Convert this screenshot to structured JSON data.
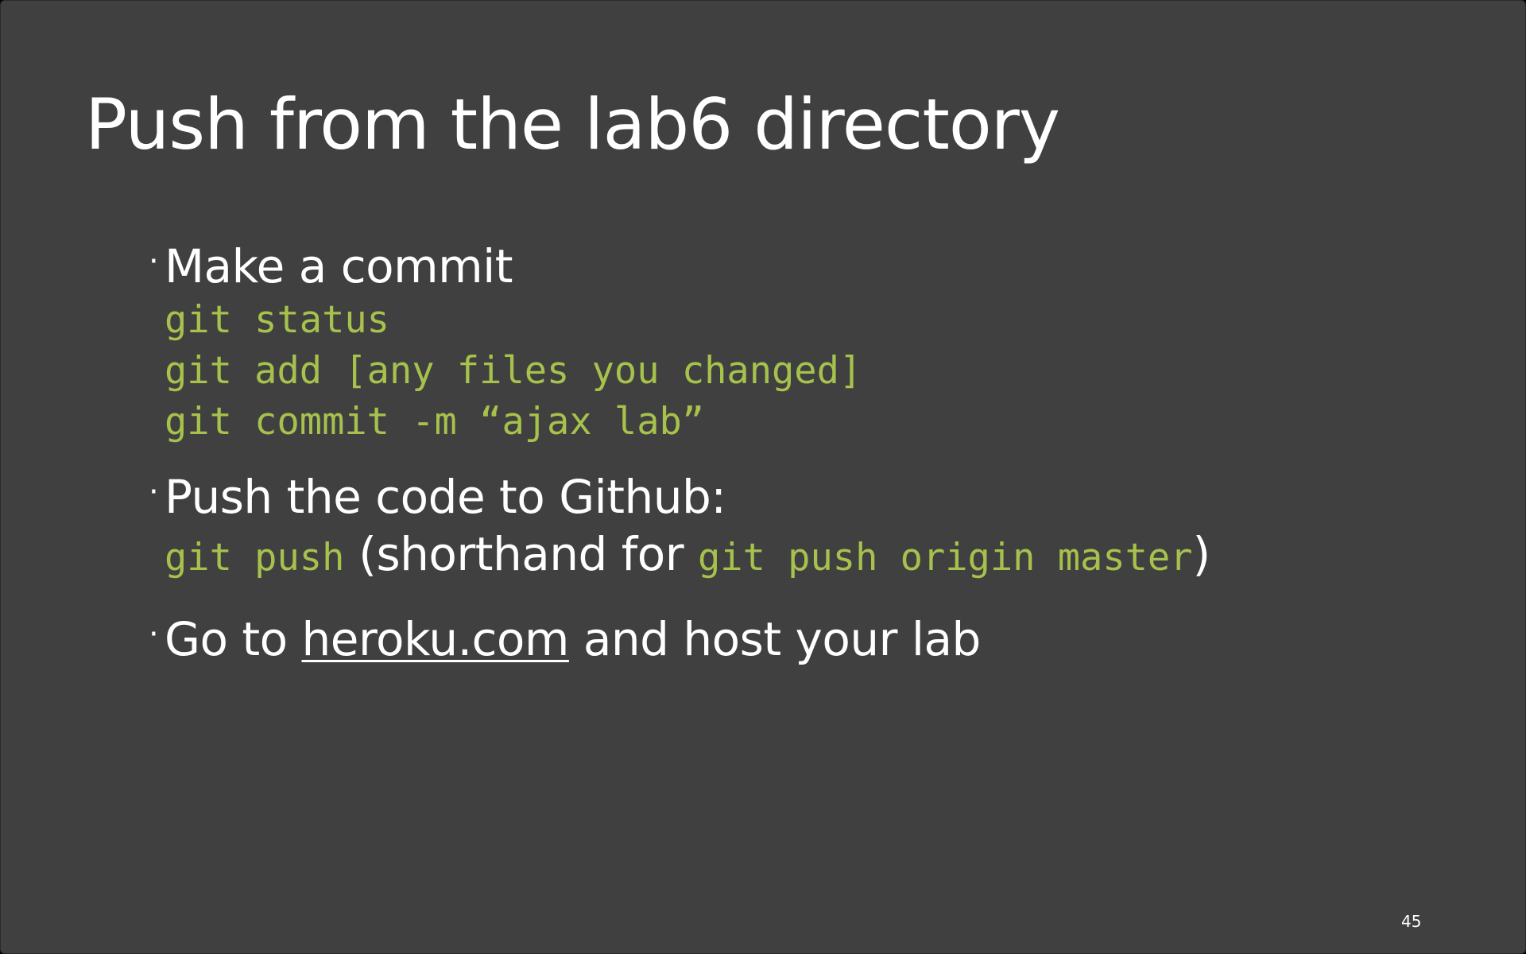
{
  "slide": {
    "title": "Push from the lab6 directory",
    "bullets": [
      {
        "dot": "·",
        "text": "Make a commit",
        "code_lines": [
          "git status",
          "git add [any files you changed]",
          "git commit -m “ajax lab”"
        ]
      },
      {
        "dot": "·",
        "text": "Push the code to Github:",
        "mixed_line": {
          "code1": "git push",
          "text1": " (shorthand for ",
          "code2": "git push origin master",
          "text2": ")"
        }
      },
      {
        "dot": "·",
        "text_before": "Go to ",
        "link": "heroku.com",
        "text_after": " and host your lab"
      }
    ],
    "page_number": "45"
  },
  "colors": {
    "background": "#404040",
    "text": "#ffffff",
    "code": "#a6c24c"
  }
}
